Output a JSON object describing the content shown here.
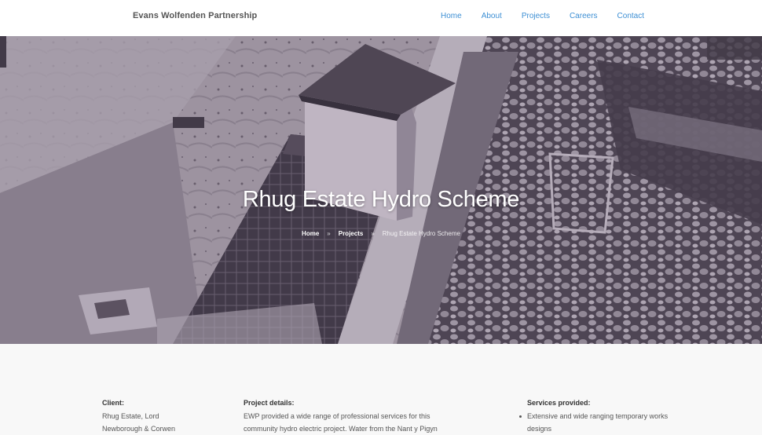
{
  "site": {
    "brand": "Evans Wolfenden Partnership"
  },
  "nav": {
    "items": [
      {
        "label": "Home"
      },
      {
        "label": "About"
      },
      {
        "label": "Projects"
      },
      {
        "label": "Careers"
      },
      {
        "label": "Contact"
      }
    ]
  },
  "hero": {
    "title": "Rhug Estate Hydro Scheme",
    "breadcrumb": {
      "home": "Home",
      "projects": "Projects",
      "current": "Rhug Estate Hydro Scheme",
      "separator": "»"
    }
  },
  "details": {
    "client": {
      "heading": "Client:",
      "text": "Rhug Estate, Lord Newborough & Corwen"
    },
    "project": {
      "heading": "Project details:",
      "text": "EWP provided a wide range of professional services for this community hydro electric project. Water from the Nant y Pigyn"
    },
    "services": {
      "heading": "Services provided:",
      "items": [
        "Extensive and wide ranging temporary works designs"
      ]
    }
  },
  "colors": {
    "link": "#3d8fd4",
    "brand_text": "#555555",
    "hero_tint": "#5a5360",
    "page_bg": "#f8f8f8"
  }
}
